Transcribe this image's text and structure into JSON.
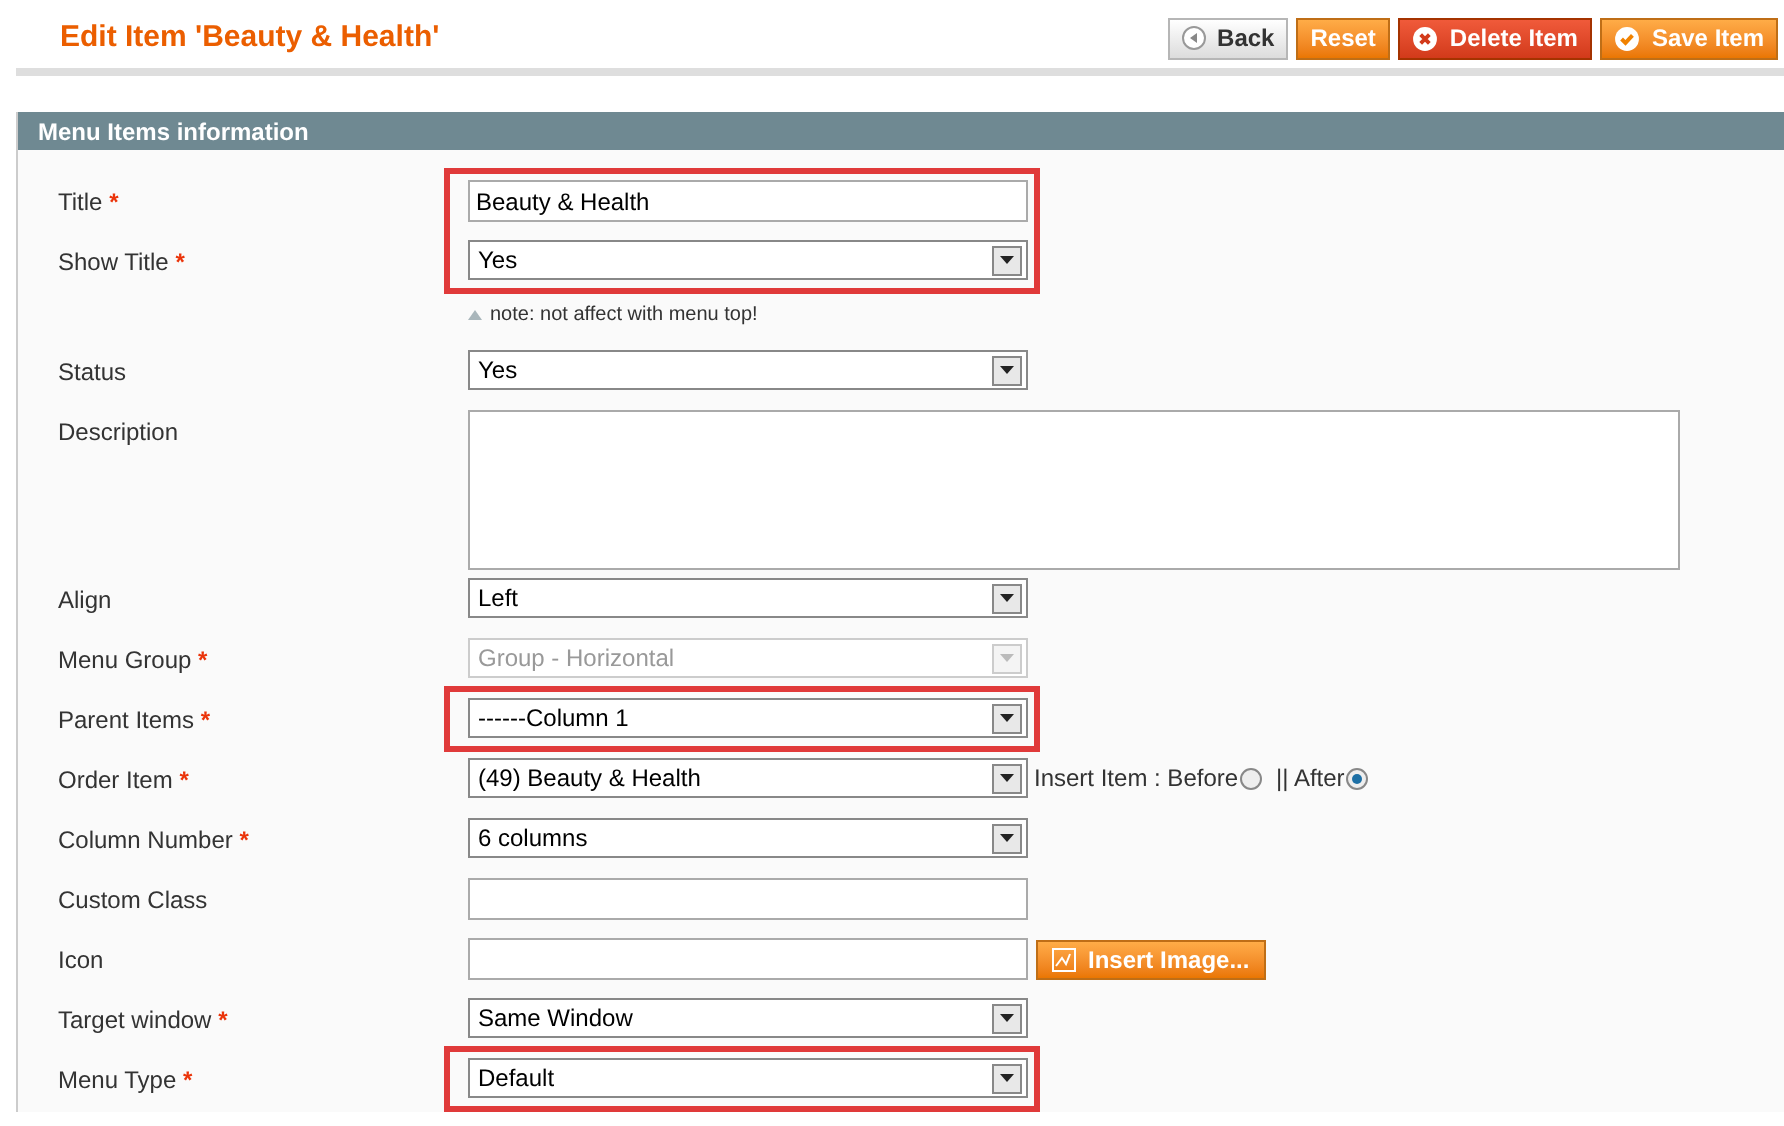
{
  "page_title": "Edit Item 'Beauty & Health'",
  "actions": [
    {
      "label": "Back",
      "kind": "back"
    },
    {
      "label": "Reset",
      "kind": "plain"
    },
    {
      "label": "Delete Item",
      "kind": "delete"
    },
    {
      "label": "Save Item",
      "kind": "save"
    }
  ],
  "section": {
    "title": "Menu Items information"
  },
  "groups": [
    {
      "highlighted": true,
      "fields": [
        {
          "label": "Title",
          "required_mark": "*",
          "kind": "text",
          "value": "Beauty & Health"
        },
        {
          "label": "Show Title",
          "required_mark": "*",
          "kind": "select",
          "value": "Yes"
        }
      ]
    },
    {
      "highlighted": false,
      "note": "note: not affect with menu top!",
      "fields": [
        {
          "label": "Status",
          "kind": "select",
          "value": "Yes"
        },
        {
          "label": "Description",
          "kind": "textarea"
        },
        {
          "label": "Align",
          "kind": "select",
          "value": "Left"
        },
        {
          "label": "Menu Group",
          "required_mark": "*",
          "kind": "select",
          "value": "Group - Horizontal",
          "disabled": true
        }
      ]
    },
    {
      "highlighted": true,
      "fields": [
        {
          "label": "Parent Items",
          "required_mark": "*",
          "kind": "select",
          "value": "------Column 1"
        }
      ]
    },
    {
      "highlighted": false,
      "fields": [
        {
          "label": "Order Item",
          "required_mark": "*",
          "kind": "select",
          "value": "(49) Beauty & Health",
          "options": [
            {
              "label": "Insert Item : Before",
              "selected": false
            },
            {
              "label": "|| After",
              "selected": true
            }
          ]
        },
        {
          "label": "Column Number",
          "required_mark": "*",
          "kind": "select",
          "value": "6 columns"
        },
        {
          "label": "Custom Class",
          "kind": "text"
        },
        {
          "label": "Icon",
          "kind": "text",
          "button": "Insert Image..."
        },
        {
          "label": "Target window",
          "required_mark": "*",
          "kind": "select",
          "value": "Same Window"
        }
      ]
    },
    {
      "highlighted": true,
      "fields": [
        {
          "label": "Menu Type",
          "required_mark": "*",
          "kind": "select",
          "value": "Default"
        }
      ]
    }
  ]
}
